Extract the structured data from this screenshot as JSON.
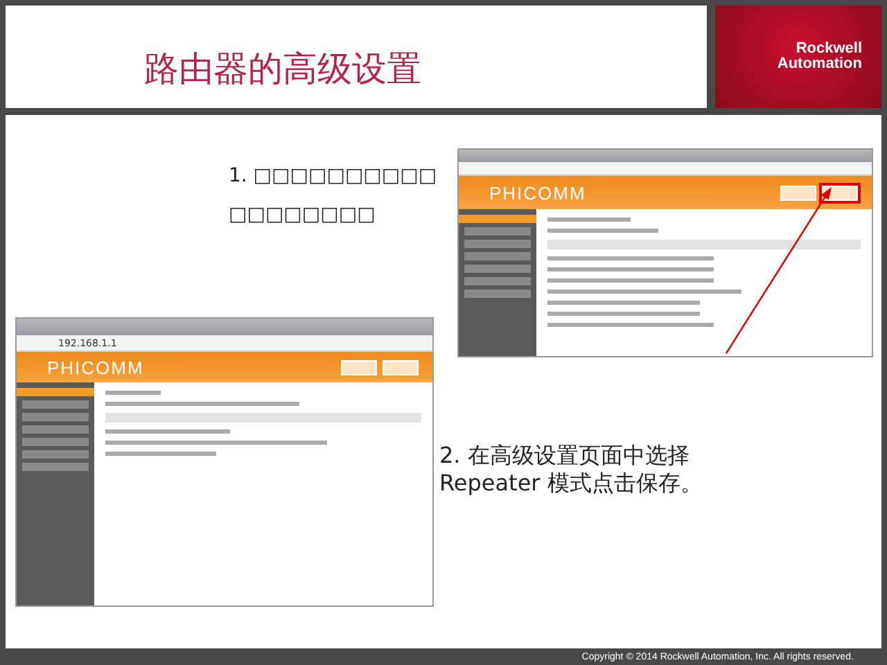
{
  "title": "路由器的高级设置",
  "logo": {
    "line1": "Rockwell",
    "line2": "Automation"
  },
  "steps": [
    {
      "text": "1. □□□□□□□□□□□□□□□□□□"
    },
    {
      "text": "2. 在高级设置页面中选择 Repeater 模式点击保存。"
    }
  ],
  "screenshots": [
    {
      "logo": "PHICOMM"
    },
    {
      "logo": "PHICOMM",
      "url": "192.168.1.1"
    }
  ],
  "footer": "Copyright © 2014 Rockwell Automation, Inc. All rights reserved."
}
